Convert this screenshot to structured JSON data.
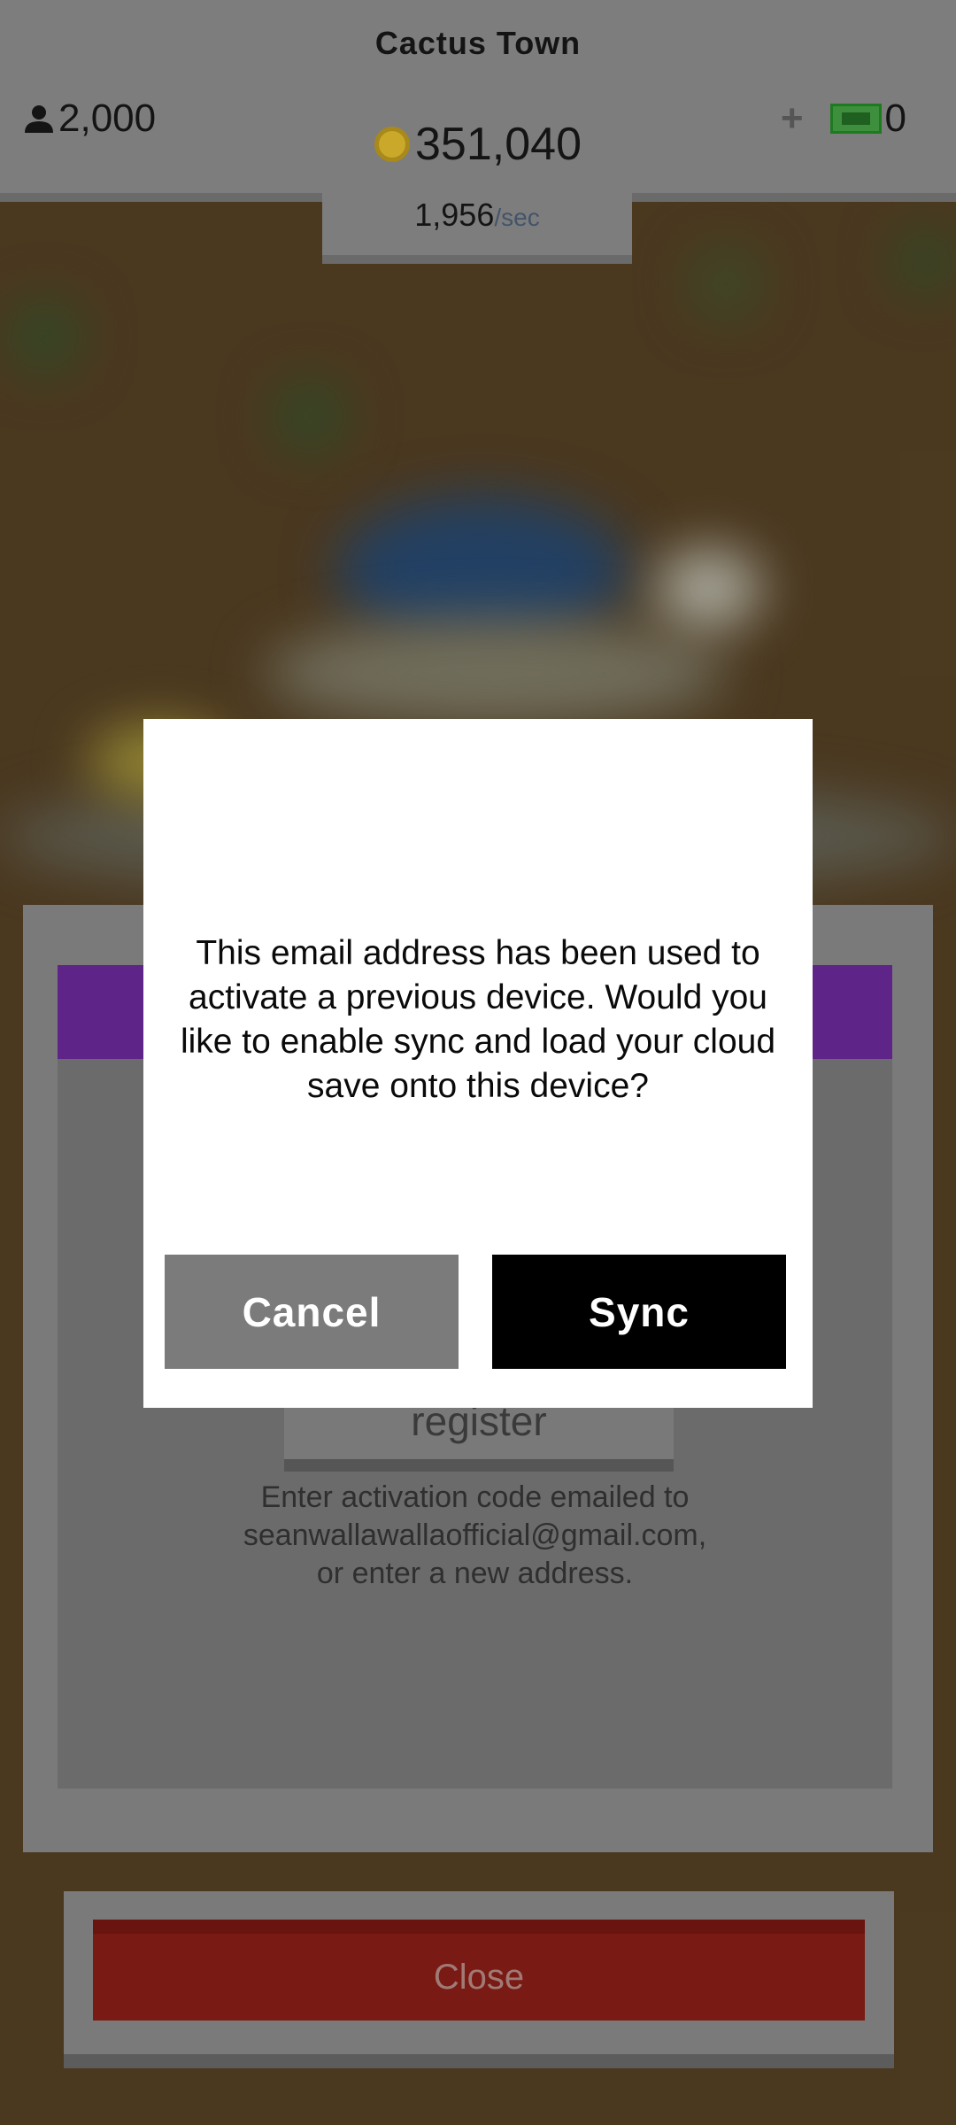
{
  "header": {
    "town_name": "Cactus Town",
    "population": "2,000",
    "coins": "351,040",
    "cash_plus": "+",
    "cash": "0",
    "rate_value": "1,956",
    "rate_unit": "/sec"
  },
  "register_panel": {
    "register_label": "register",
    "info_lines": [
      "Enter activation code emailed to",
      "seanwallawallaofficial@gmail.com,",
      "or enter a new address."
    ]
  },
  "close_label": "Close",
  "dialog": {
    "message": "This email address has been used to activate a previous device. Would you like to enable sync and load your cloud save onto this device?",
    "cancel_label": "Cancel",
    "sync_label": "Sync"
  },
  "colors": {
    "purple": "#5e2487",
    "close_red": "#7a1a14",
    "sync_button": "#000000",
    "cancel_button": "#7b7b7b"
  },
  "icons": {
    "population": "person-icon",
    "coins": "coin-icon",
    "cash": "cash-bill-icon"
  }
}
